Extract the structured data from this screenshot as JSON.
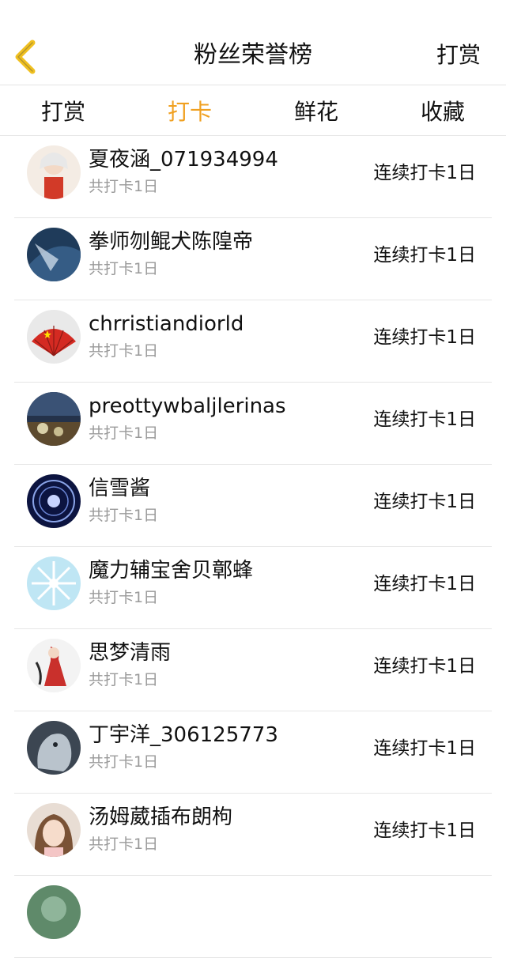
{
  "header": {
    "title": "粉丝荣誉榜",
    "action_label": "打赏",
    "back_icon": "chevron-left-icon",
    "back_color": "#f0c020"
  },
  "tabs": [
    {
      "label": "打赏",
      "active": false
    },
    {
      "label": "打卡",
      "active": true
    },
    {
      "label": "鲜花",
      "active": false
    },
    {
      "label": "收藏",
      "active": false
    }
  ],
  "accent_color": "#f0a020",
  "list": [
    {
      "name": "夏夜涵_071934994",
      "total": "共打卡1日",
      "streak": "连续打卡1日"
    },
    {
      "name": "拳师刎鲲犬陈隍帝",
      "total": "共打卡1日",
      "streak": "连续打卡1日"
    },
    {
      "name": "chrristiandiorld",
      "total": "共打卡1日",
      "streak": "连续打卡1日"
    },
    {
      "name": "preottywbaljlerinas",
      "total": "共打卡1日",
      "streak": "连续打卡1日"
    },
    {
      "name": "信雪酱",
      "total": "共打卡1日",
      "streak": "连续打卡1日"
    },
    {
      "name": "魔力辅宝舍贝鄣蜂",
      "total": "共打卡1日",
      "streak": "连续打卡1日"
    },
    {
      "name": "思梦清雨",
      "total": "共打卡1日",
      "streak": "连续打卡1日"
    },
    {
      "name": "丁宇洋_306125773",
      "total": "共打卡1日",
      "streak": "连续打卡1日"
    },
    {
      "name": "汤姆葳插布朗枸",
      "total": "共打卡1日",
      "streak": "连续打卡1日"
    }
  ]
}
